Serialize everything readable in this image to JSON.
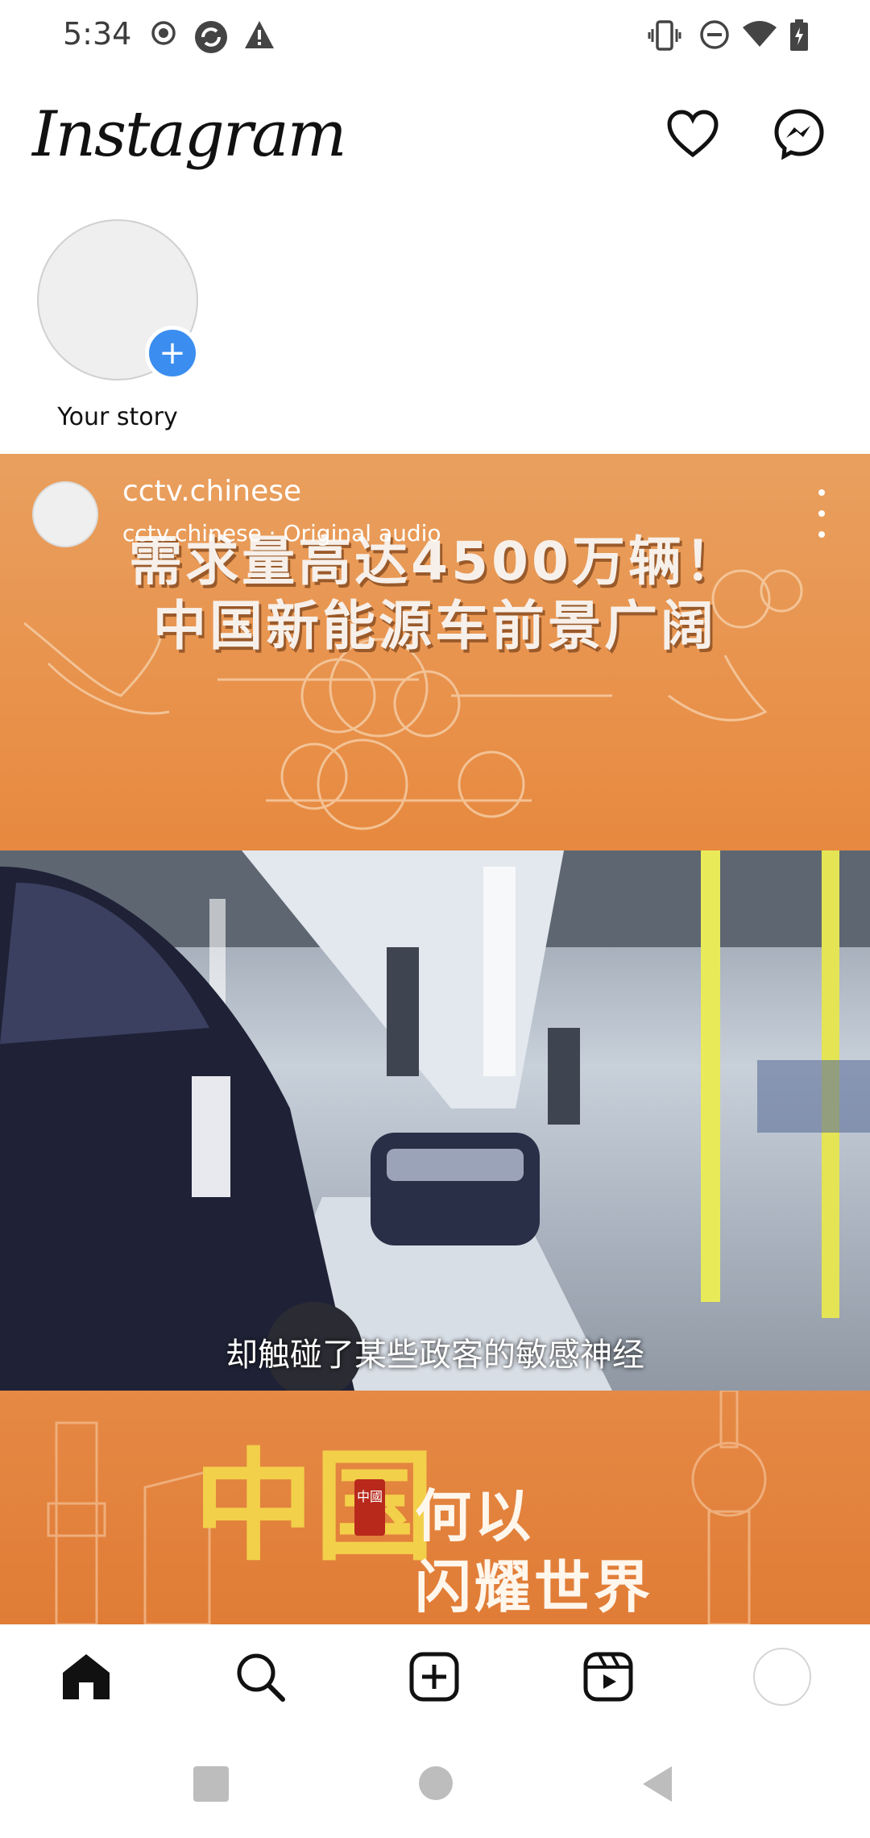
{
  "status_bar": {
    "time": "5:34",
    "left_icons": [
      "record-icon",
      "sync-icon",
      "warning-icon"
    ],
    "right_icons": [
      "vibrate-icon",
      "dnd-icon",
      "wifi-icon",
      "battery-icon"
    ]
  },
  "header": {
    "logo_text": "Instagram",
    "icons": [
      "heart-icon",
      "messenger-icon"
    ]
  },
  "stories": {
    "items": [
      {
        "label": "Your story"
      }
    ]
  },
  "post": {
    "username": "cctv.chinese",
    "audio": "cctv.chinese · Original audio",
    "headline_line1": "需求量高达4500万辆！",
    "headline_line2": "中国新能源车前景广阔",
    "subtitle": "却触碰了某些政客的敏感神经",
    "bottom_big_char": "中国",
    "bottom_seal": "中國",
    "bottom_line1": "何以",
    "bottom_line2": "闪耀世界",
    "accent_color": "#e8924c"
  },
  "bottom_nav": {
    "items": [
      "home-icon",
      "search-icon",
      "create-icon",
      "reels-icon",
      "profile-avatar"
    ]
  },
  "system_nav": {
    "buttons": [
      "recents-button",
      "home-button",
      "back-button"
    ]
  }
}
